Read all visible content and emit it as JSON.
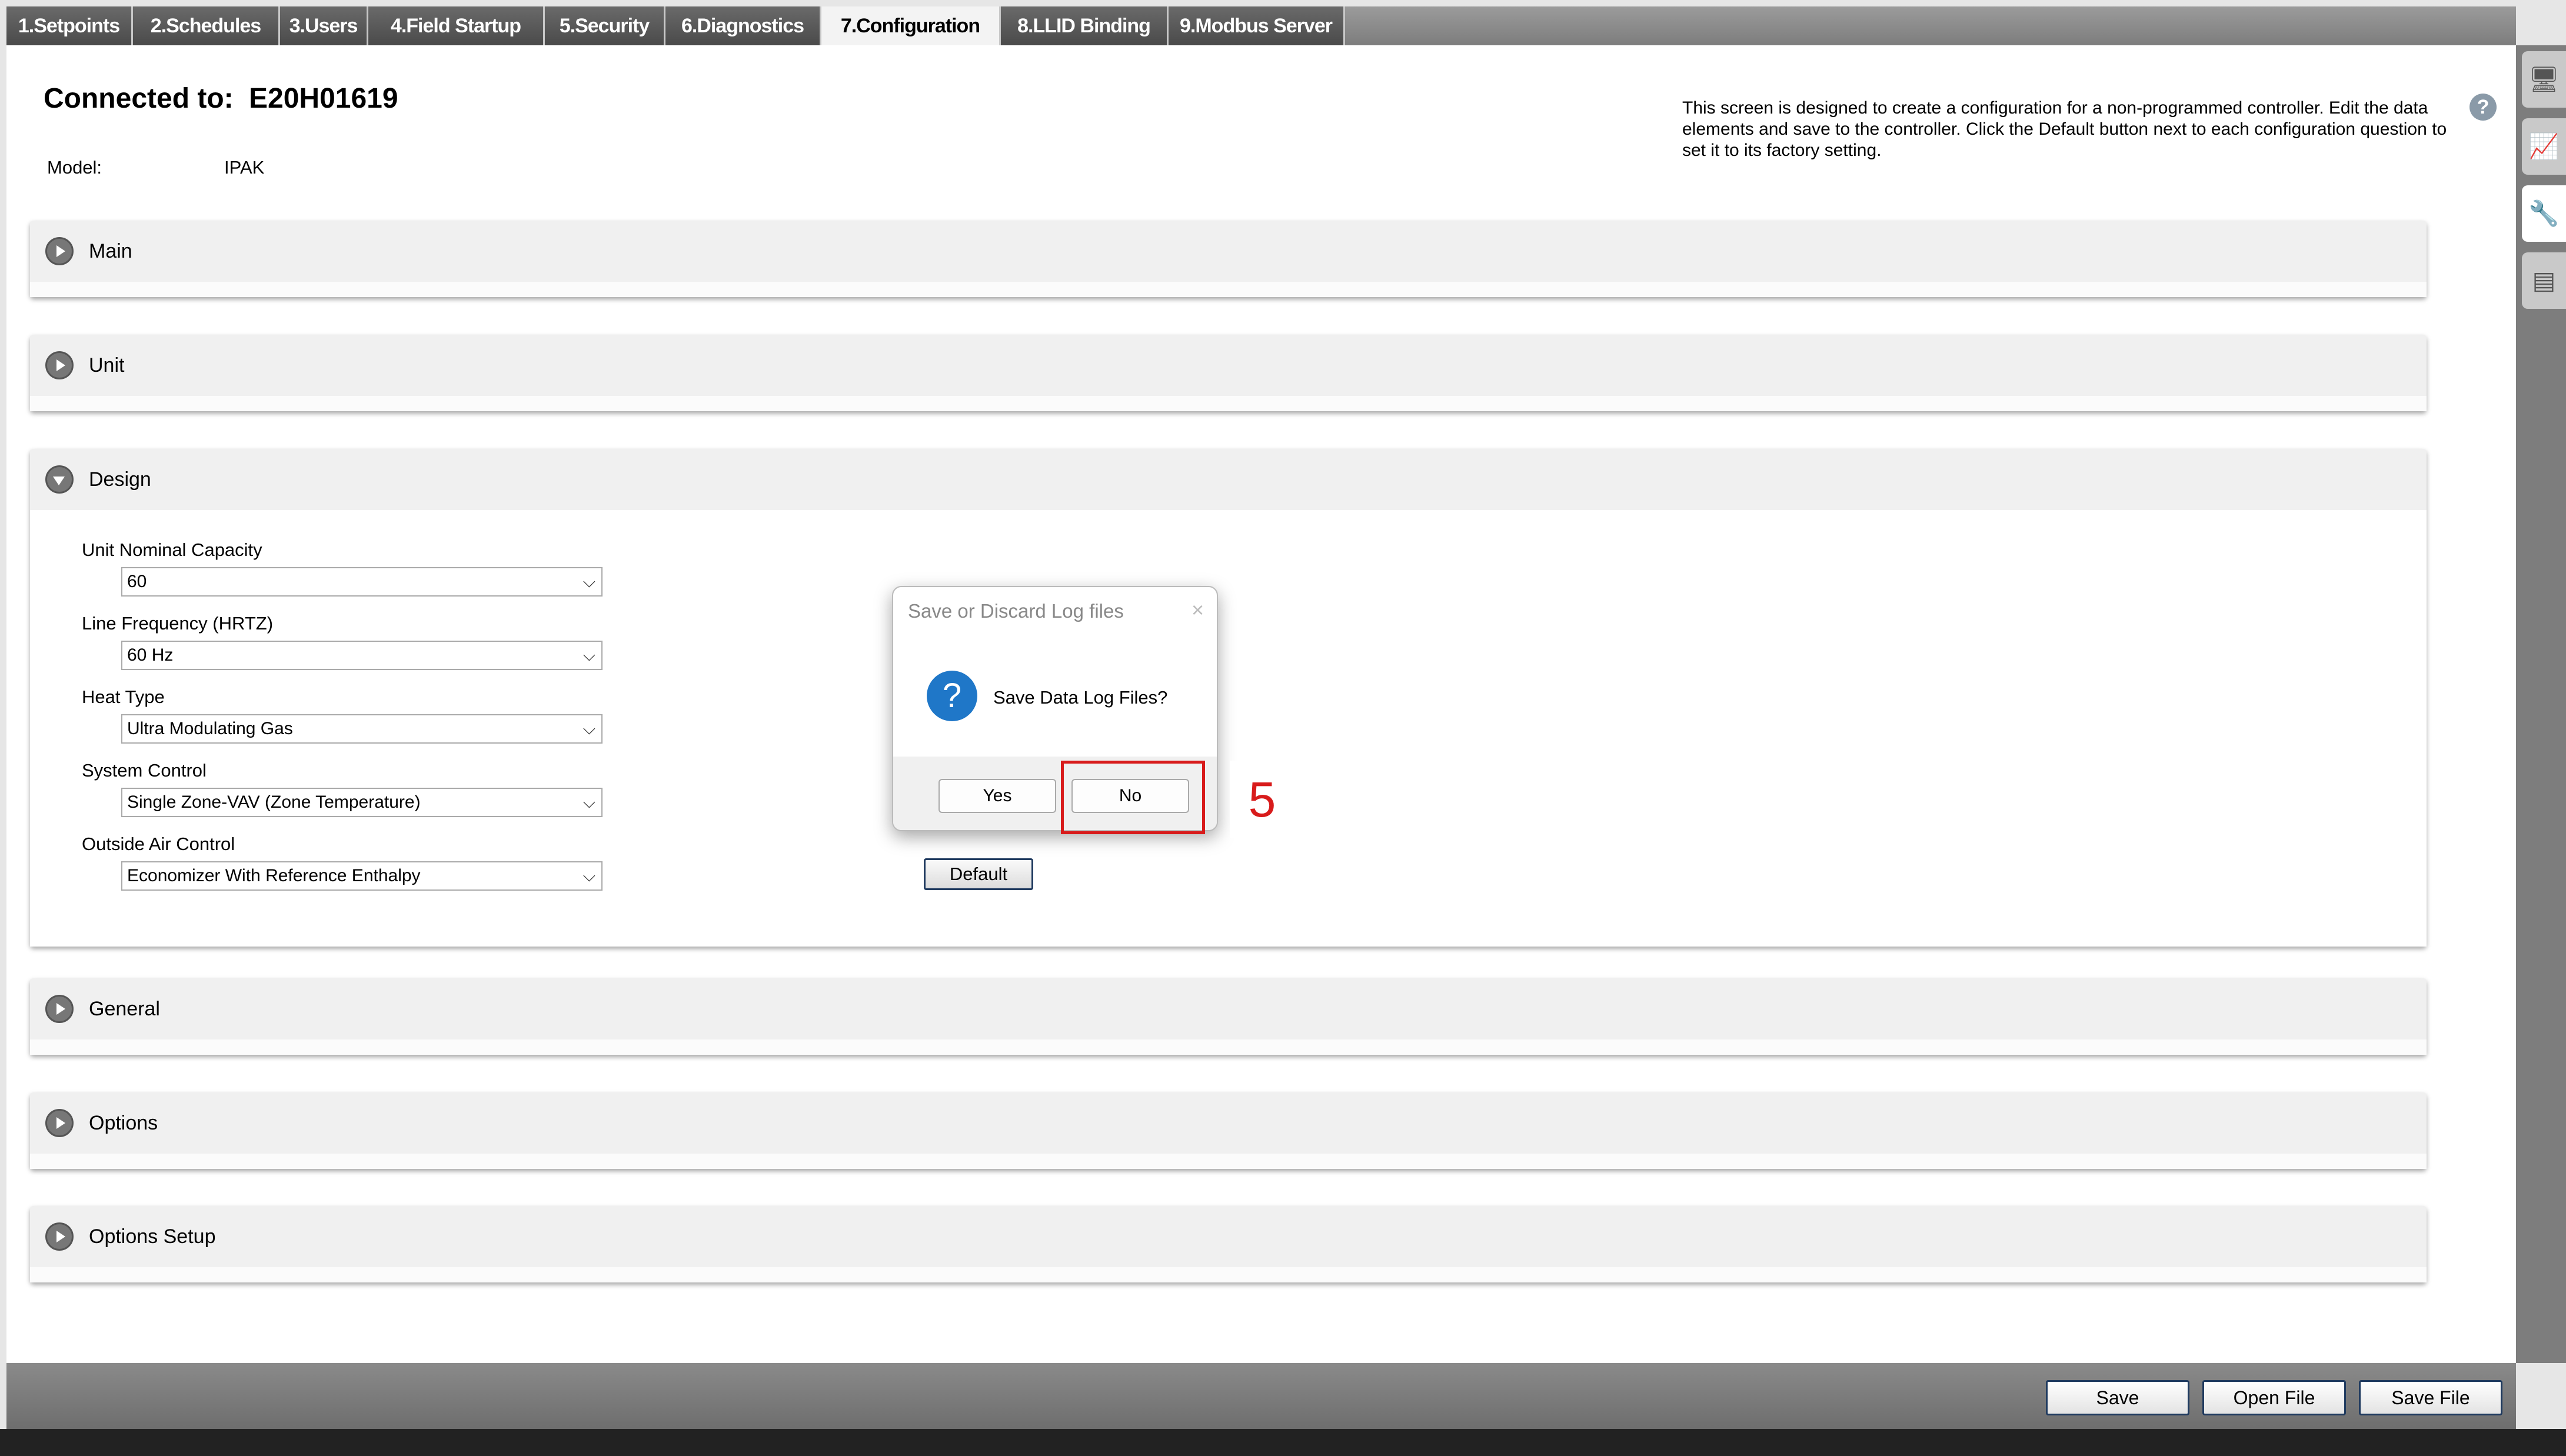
{
  "tabs": [
    {
      "label": "1.Setpoints",
      "active": false
    },
    {
      "label": "2.Schedules",
      "active": false
    },
    {
      "label": "3.Users",
      "active": false
    },
    {
      "label": "4.Field Startup",
      "active": false
    },
    {
      "label": "5.Security",
      "active": false
    },
    {
      "label": "6.Diagnostics",
      "active": false
    },
    {
      "label": "7.Configuration",
      "active": true
    },
    {
      "label": "8.LLID Binding",
      "active": false
    },
    {
      "label": "9.Modbus Server",
      "active": false
    }
  ],
  "header": {
    "connected_label": "Connected to:",
    "connected_value": "E20H01619",
    "model_label": "Model:",
    "model_value": "IPAK",
    "help_text": "This screen is designed to create a configuration for a non-programmed controller. Edit the data elements and save to the controller. Click the Default button next to each configuration question to set it to its factory setting.",
    "help_icon": "?"
  },
  "sections": {
    "main": "Main",
    "unit": "Unit",
    "design": "Design",
    "general": "General",
    "options": "Options",
    "options_setup": "Options Setup"
  },
  "design_fields": [
    {
      "label": "Unit Nominal Capacity",
      "value": "60"
    },
    {
      "label": "Line Frequency (HRTZ)",
      "value": "60 Hz"
    },
    {
      "label": "Heat Type",
      "value": "Ultra Modulating Gas"
    },
    {
      "label": "System Control",
      "value": "Single Zone-VAV (Zone Temperature)"
    },
    {
      "label": "Outside Air Control",
      "value": "Economizer With Reference Enthalpy"
    }
  ],
  "default_label": "Default",
  "dropdown_chevron": "⌵",
  "bottom_buttons": {
    "save": "Save",
    "open_file": "Open File",
    "save_file": "Save File"
  },
  "sidebar_icons": [
    "monitor-icon",
    "chart-icon",
    "wrench-icon",
    "layers-icon"
  ],
  "dialog": {
    "title": "Save or Discard Log files",
    "close": "×",
    "icon": "?",
    "message": "Save Data Log Files?",
    "yes": "Yes",
    "no": "No"
  },
  "annotation": {
    "step": "5",
    "color": "#d81b1b"
  }
}
